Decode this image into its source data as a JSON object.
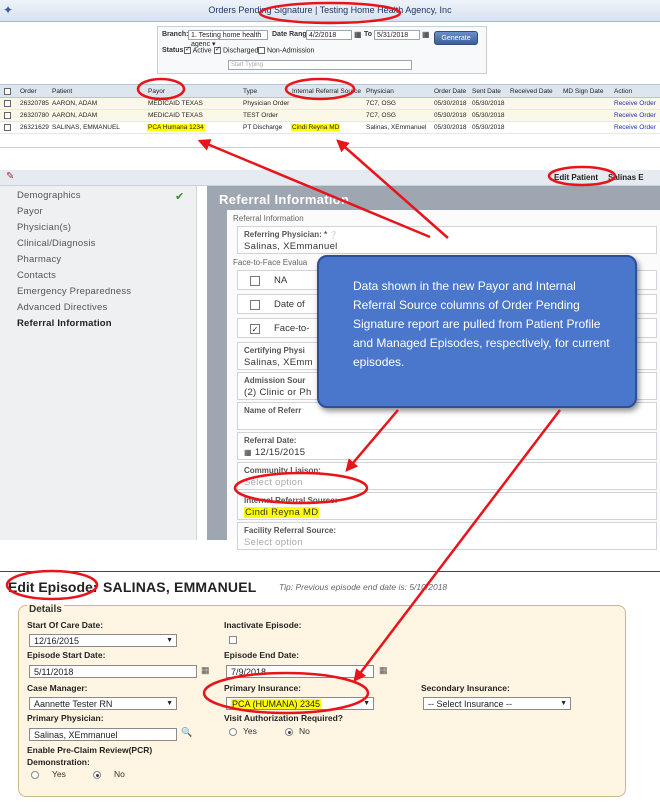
{
  "report": {
    "title": "Orders Pending Signature | Testing Home Health Agency, Inc",
    "branch_label": "Branch:",
    "branch_value": "1. Testing home health agenc ▾",
    "date_range_label": "Date Range:",
    "date_from": "4/2/2018",
    "to_label": "To",
    "date_to": "5/31/2018",
    "status_label": "Status:",
    "status_options": [
      "Active",
      "Discharged",
      "Non-Admission"
    ],
    "start_typing_placeholder": "Start Typing",
    "generate_label": "Generate",
    "columns": [
      "Order",
      "Patient",
      "Payor",
      "Type",
      "Internal Referral Source",
      "Physician",
      "Order Date",
      "Sent Date",
      "Received Date",
      "MD Sign Date",
      "Action"
    ],
    "rows": [
      {
        "order": "26320785",
        "patient": "AARON, ADAM",
        "payor": "MEDICAID TEXAS",
        "type": "Physician Order",
        "irs": "",
        "physician": "7C7, OSG",
        "order_date": "05/30/2018",
        "sent_date": "05/30/2018",
        "received_date": "",
        "md_sign_date": "",
        "action": "Receive Order"
      },
      {
        "order": "26320780",
        "patient": "AARON, ADAM",
        "payor": "MEDICAID TEXAS",
        "type": "TEST Order",
        "irs": "",
        "physician": "7C7, OSG",
        "order_date": "05/30/2018",
        "sent_date": "05/30/2018",
        "received_date": "",
        "md_sign_date": "",
        "action": "Receive Order"
      },
      {
        "order": "26321629",
        "patient": "SALINAS, EMMANUEL",
        "payor": "PCA Humana 1234",
        "type": "PT Discharge",
        "irs": "Cindi Reyna MD",
        "physician": "Salinas, XEmmanuel",
        "order_date": "05/30/2018",
        "sent_date": "05/30/2018",
        "received_date": "",
        "md_sign_date": "",
        "action": "Receive Order"
      }
    ]
  },
  "patient": {
    "edit_patient_label": "Edit Patient",
    "patient_name_partial": "Salinas E",
    "nav": [
      "Demographics",
      "Payor",
      "Physician(s)",
      "Clinical/Diagnosis",
      "Pharmacy",
      "Contacts",
      "Emergency Preparedness",
      "Advanced Directives",
      "Referral Information"
    ],
    "header": "Referral Information",
    "section_label": "Referral Information",
    "referring_physician_label": "Referring Physician: *",
    "referring_physician_value": "Salinas, XEmmanuel",
    "f2f_label": "Face-to-Face Evalua",
    "f2f_options": [
      "NA",
      "Date of",
      "Face-to-"
    ],
    "certifying_label": "Certifying Physi",
    "certifying_value": "Salinas, XEmm",
    "admission_source_label": "Admission Sour",
    "admission_source_value": "(2) Clinic or Ph",
    "name_referral_label": "Name of Referr",
    "referral_date_label": "Referral Date:",
    "referral_date_value": "12/15/2015",
    "community_liaison_label": "Community Liaison:",
    "select_placeholder": "Select option",
    "internal_referral_label": "Internal Referral Source:",
    "internal_referral_value": "Cindi Reyna MD",
    "facility_referral_label": "Facility Referral Source:"
  },
  "callout_text": "Data shown in the new Payor and Internal Referral Source columns of Order Pending Signature report are pulled from Patient Profile and Managed Episodes, respectively, for current episodes.",
  "episode": {
    "title": "Edit Episode:",
    "patient_name": "SALINAS, EMMANUEL",
    "tip": "Tip: Previous episode end date is: 5/10/2018",
    "details_label": "Details",
    "soc_label": "Start Of Care Date:",
    "soc_value": "12/16/2015",
    "inactivate_label": "Inactivate Episode:",
    "start_label": "Episode Start Date:",
    "start_value": "5/11/2018",
    "end_label": "Episode End Date:",
    "end_value": "7/9/2018",
    "case_manager_label": "Case Manager:",
    "case_manager_value": "Aannette Tester RN",
    "primary_ins_label": "Primary Insurance:",
    "primary_ins_value": "PCA (HUMANA) 2345",
    "secondary_ins_label": "Secondary Insurance:",
    "secondary_ins_value": "-- Select Insurance --",
    "primary_phys_label": "Primary Physician:",
    "primary_phys_value": "Salinas, XEmmanuel",
    "visit_auth_label": "Visit Authorization Required?",
    "yes": "Yes",
    "no": "No",
    "pcr_label": "Enable Pre-Claim Review(PCR)",
    "demo_label": "Demonstration:"
  },
  "colors": {
    "annotation_red": "#e8141a",
    "highlight": "#ffff00",
    "callout_blue": "#4a76cc"
  }
}
